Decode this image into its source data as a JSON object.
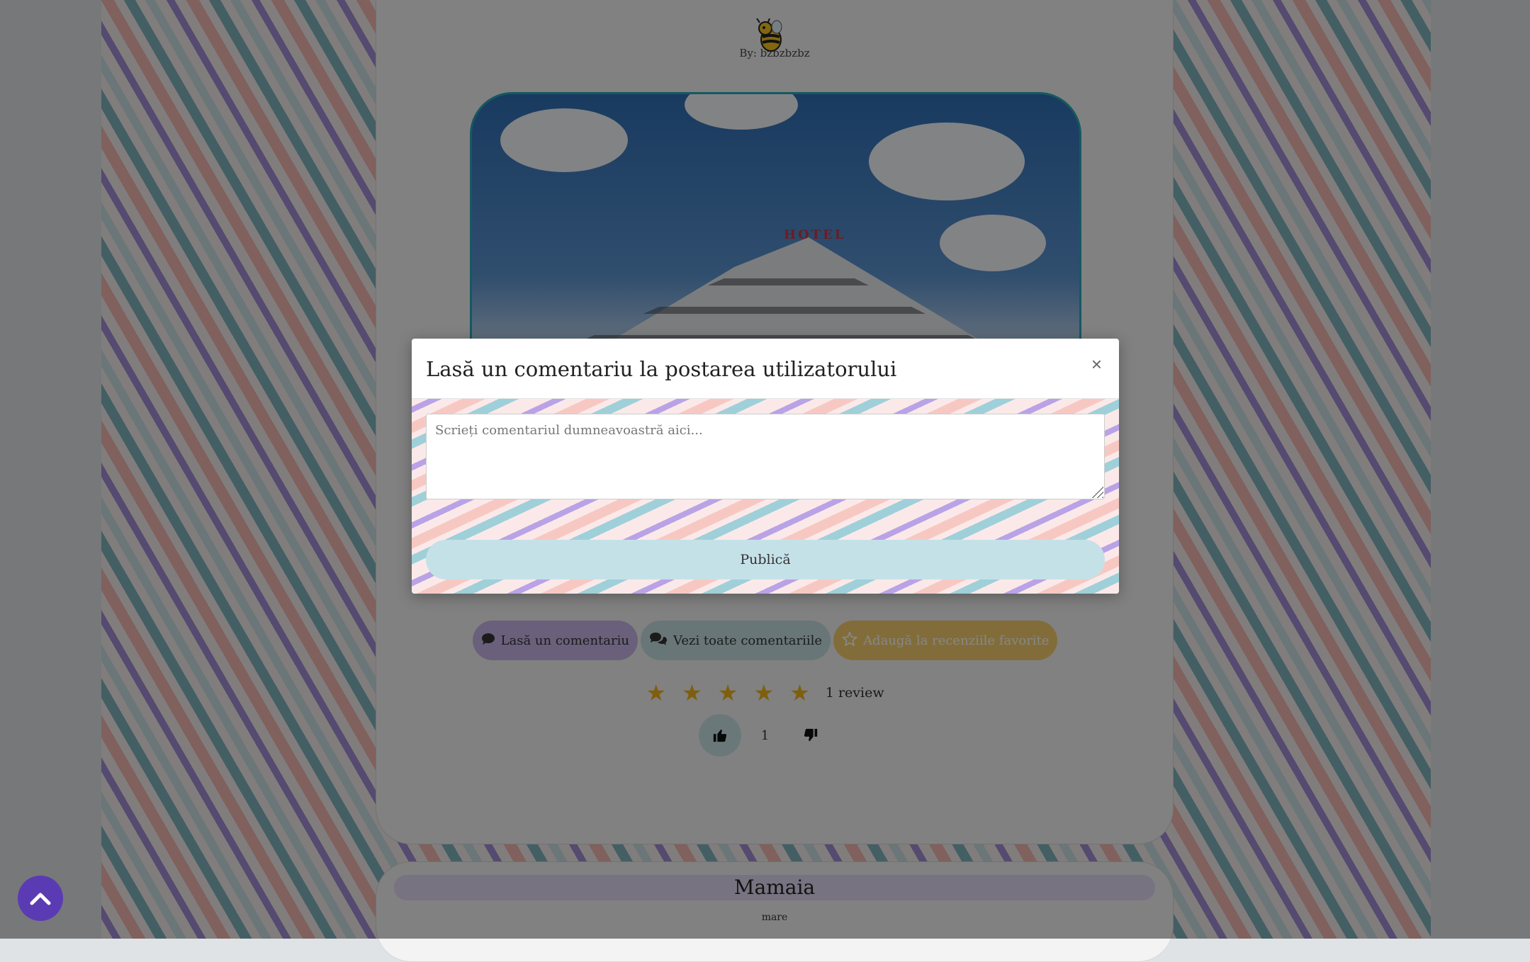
{
  "post": {
    "author_label": "By: bzbzbzbz",
    "hero_sign": "HOTEL"
  },
  "actions": {
    "comment": "Lasă un comentariu",
    "view_comments": "Vezi toate comentariile",
    "favorite": "Adaugă la recenziile favorite"
  },
  "rating": {
    "stars": 5,
    "review_count_label": "1 review"
  },
  "votes": {
    "count": "1"
  },
  "next_post": {
    "title": "Mamaia",
    "subtitle": "mare"
  },
  "modal": {
    "title": "Lasă un comentariu la postarea utilizatorului",
    "close": "×",
    "comment_placeholder": "Scrieți comentariul dumneavoastră aici...",
    "publish": "Publică"
  },
  "colors": {
    "accent_purple": "#c8b6e8",
    "accent_teal": "#c5dfe3",
    "accent_gold": "#f5cf6e",
    "scroll_button": "#5b3bb3",
    "star": "#f0b41b"
  },
  "icons": {
    "comment": "comment-icon",
    "comments": "comments-icon",
    "favorite": "star-outline-icon",
    "thumbs_up": "thumbs-up-icon",
    "thumbs_down": "thumbs-down-icon",
    "scroll_top": "chevron-up-icon",
    "avatar": "bee-avatar-icon"
  }
}
